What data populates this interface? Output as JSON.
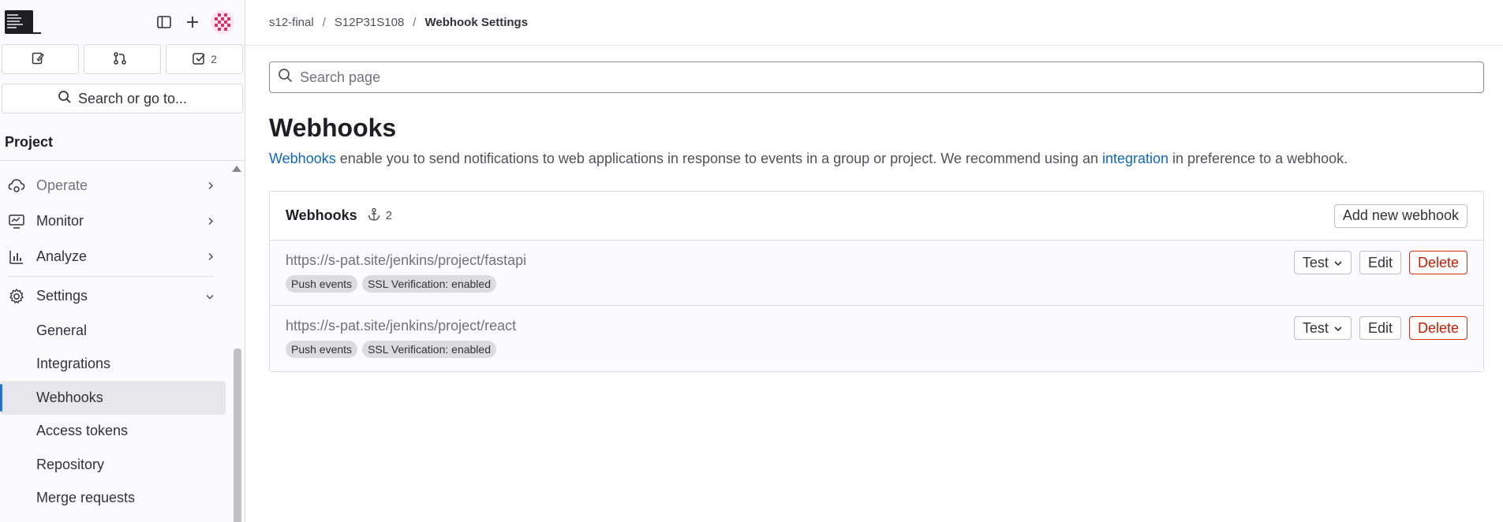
{
  "sidebar": {
    "counts": [
      {
        "icon": "issues-icon",
        "label": ""
      },
      {
        "icon": "merge-request-icon",
        "label": ""
      },
      {
        "icon": "todo-icon",
        "label": "2"
      }
    ],
    "search_label": "Search or go to...",
    "section_title": "Project",
    "nav": [
      {
        "label": "Operate",
        "icon": "cloud-gear-icon"
      },
      {
        "label": "Monitor",
        "icon": "monitor-icon"
      },
      {
        "label": "Analyze",
        "icon": "chart-icon"
      },
      {
        "label": "Settings",
        "icon": "gear-icon"
      }
    ],
    "settings_items": [
      "General",
      "Integrations",
      "Webhooks",
      "Access tokens",
      "Repository",
      "Merge requests"
    ],
    "active_item": "Webhooks"
  },
  "breadcrumb": {
    "group": "s12-final",
    "project": "S12P31S108",
    "current": "Webhook Settings"
  },
  "search": {
    "placeholder": "Search page"
  },
  "page": {
    "title": "Webhooks",
    "intro_link1": "Webhooks",
    "intro_text1": " enable you to send notifications to web applications in response to events in a group or project. We recommend using an ",
    "intro_link2": "integration",
    "intro_text2": " in preference to a webhook."
  },
  "webhooks_card": {
    "title": "Webhooks",
    "count": "2",
    "add_button": "Add new webhook",
    "hooks": [
      {
        "url": "https://s-pat.site/jenkins/project/fastapi",
        "badges": [
          "Push events",
          "SSL Verification: enabled"
        ]
      },
      {
        "url": "https://s-pat.site/jenkins/project/react",
        "badges": [
          "Push events",
          "SSL Verification: enabled"
        ]
      }
    ],
    "test_label": "Test",
    "edit_label": "Edit",
    "delete_label": "Delete"
  },
  "colors": {
    "link": "#1068bf",
    "danger": "#c91c00",
    "active_indicator": "#1f75cb"
  }
}
